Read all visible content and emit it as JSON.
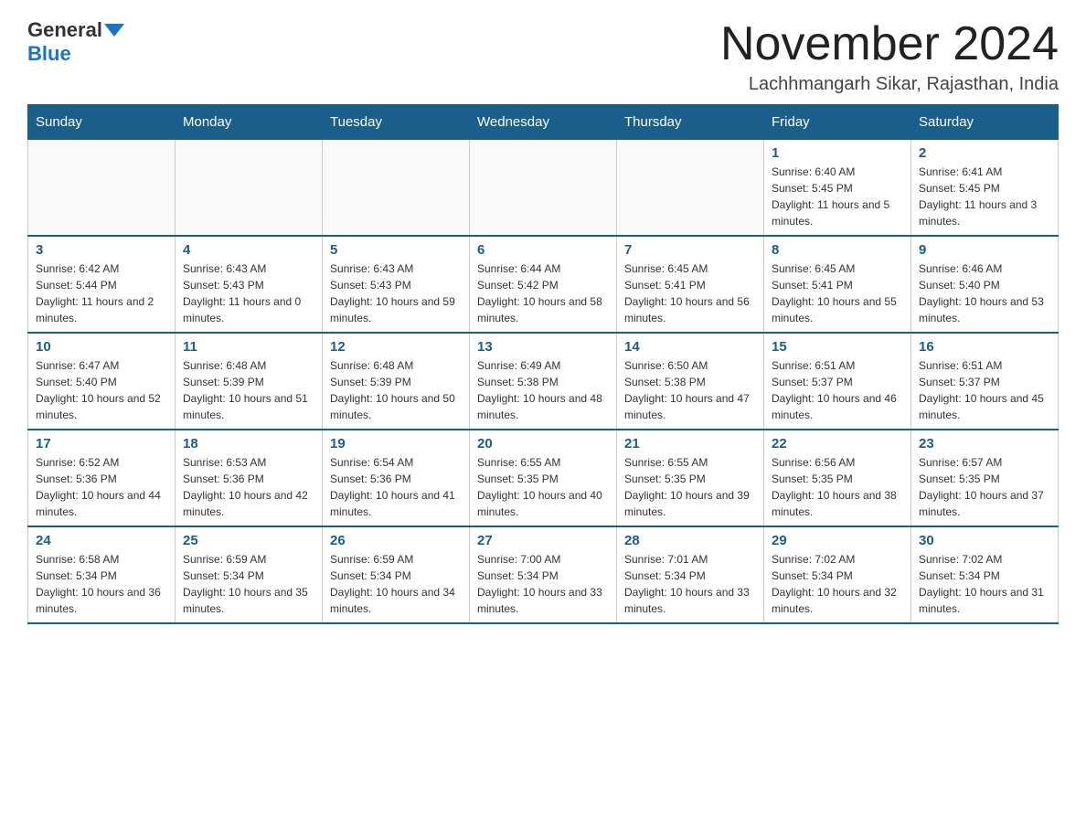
{
  "header": {
    "logo_general": "General",
    "logo_blue": "Blue",
    "month_title": "November 2024",
    "subtitle": "Lachhmangarh Sikar, Rajasthan, India"
  },
  "days_of_week": [
    "Sunday",
    "Monday",
    "Tuesday",
    "Wednesday",
    "Thursday",
    "Friday",
    "Saturday"
  ],
  "weeks": [
    [
      {
        "day": "",
        "info": ""
      },
      {
        "day": "",
        "info": ""
      },
      {
        "day": "",
        "info": ""
      },
      {
        "day": "",
        "info": ""
      },
      {
        "day": "",
        "info": ""
      },
      {
        "day": "1",
        "info": "Sunrise: 6:40 AM\nSunset: 5:45 PM\nDaylight: 11 hours and 5 minutes."
      },
      {
        "day": "2",
        "info": "Sunrise: 6:41 AM\nSunset: 5:45 PM\nDaylight: 11 hours and 3 minutes."
      }
    ],
    [
      {
        "day": "3",
        "info": "Sunrise: 6:42 AM\nSunset: 5:44 PM\nDaylight: 11 hours and 2 minutes."
      },
      {
        "day": "4",
        "info": "Sunrise: 6:43 AM\nSunset: 5:43 PM\nDaylight: 11 hours and 0 minutes."
      },
      {
        "day": "5",
        "info": "Sunrise: 6:43 AM\nSunset: 5:43 PM\nDaylight: 10 hours and 59 minutes."
      },
      {
        "day": "6",
        "info": "Sunrise: 6:44 AM\nSunset: 5:42 PM\nDaylight: 10 hours and 58 minutes."
      },
      {
        "day": "7",
        "info": "Sunrise: 6:45 AM\nSunset: 5:41 PM\nDaylight: 10 hours and 56 minutes."
      },
      {
        "day": "8",
        "info": "Sunrise: 6:45 AM\nSunset: 5:41 PM\nDaylight: 10 hours and 55 minutes."
      },
      {
        "day": "9",
        "info": "Sunrise: 6:46 AM\nSunset: 5:40 PM\nDaylight: 10 hours and 53 minutes."
      }
    ],
    [
      {
        "day": "10",
        "info": "Sunrise: 6:47 AM\nSunset: 5:40 PM\nDaylight: 10 hours and 52 minutes."
      },
      {
        "day": "11",
        "info": "Sunrise: 6:48 AM\nSunset: 5:39 PM\nDaylight: 10 hours and 51 minutes."
      },
      {
        "day": "12",
        "info": "Sunrise: 6:48 AM\nSunset: 5:39 PM\nDaylight: 10 hours and 50 minutes."
      },
      {
        "day": "13",
        "info": "Sunrise: 6:49 AM\nSunset: 5:38 PM\nDaylight: 10 hours and 48 minutes."
      },
      {
        "day": "14",
        "info": "Sunrise: 6:50 AM\nSunset: 5:38 PM\nDaylight: 10 hours and 47 minutes."
      },
      {
        "day": "15",
        "info": "Sunrise: 6:51 AM\nSunset: 5:37 PM\nDaylight: 10 hours and 46 minutes."
      },
      {
        "day": "16",
        "info": "Sunrise: 6:51 AM\nSunset: 5:37 PM\nDaylight: 10 hours and 45 minutes."
      }
    ],
    [
      {
        "day": "17",
        "info": "Sunrise: 6:52 AM\nSunset: 5:36 PM\nDaylight: 10 hours and 44 minutes."
      },
      {
        "day": "18",
        "info": "Sunrise: 6:53 AM\nSunset: 5:36 PM\nDaylight: 10 hours and 42 minutes."
      },
      {
        "day": "19",
        "info": "Sunrise: 6:54 AM\nSunset: 5:36 PM\nDaylight: 10 hours and 41 minutes."
      },
      {
        "day": "20",
        "info": "Sunrise: 6:55 AM\nSunset: 5:35 PM\nDaylight: 10 hours and 40 minutes."
      },
      {
        "day": "21",
        "info": "Sunrise: 6:55 AM\nSunset: 5:35 PM\nDaylight: 10 hours and 39 minutes."
      },
      {
        "day": "22",
        "info": "Sunrise: 6:56 AM\nSunset: 5:35 PM\nDaylight: 10 hours and 38 minutes."
      },
      {
        "day": "23",
        "info": "Sunrise: 6:57 AM\nSunset: 5:35 PM\nDaylight: 10 hours and 37 minutes."
      }
    ],
    [
      {
        "day": "24",
        "info": "Sunrise: 6:58 AM\nSunset: 5:34 PM\nDaylight: 10 hours and 36 minutes."
      },
      {
        "day": "25",
        "info": "Sunrise: 6:59 AM\nSunset: 5:34 PM\nDaylight: 10 hours and 35 minutes."
      },
      {
        "day": "26",
        "info": "Sunrise: 6:59 AM\nSunset: 5:34 PM\nDaylight: 10 hours and 34 minutes."
      },
      {
        "day": "27",
        "info": "Sunrise: 7:00 AM\nSunset: 5:34 PM\nDaylight: 10 hours and 33 minutes."
      },
      {
        "day": "28",
        "info": "Sunrise: 7:01 AM\nSunset: 5:34 PM\nDaylight: 10 hours and 33 minutes."
      },
      {
        "day": "29",
        "info": "Sunrise: 7:02 AM\nSunset: 5:34 PM\nDaylight: 10 hours and 32 minutes."
      },
      {
        "day": "30",
        "info": "Sunrise: 7:02 AM\nSunset: 5:34 PM\nDaylight: 10 hours and 31 minutes."
      }
    ]
  ]
}
